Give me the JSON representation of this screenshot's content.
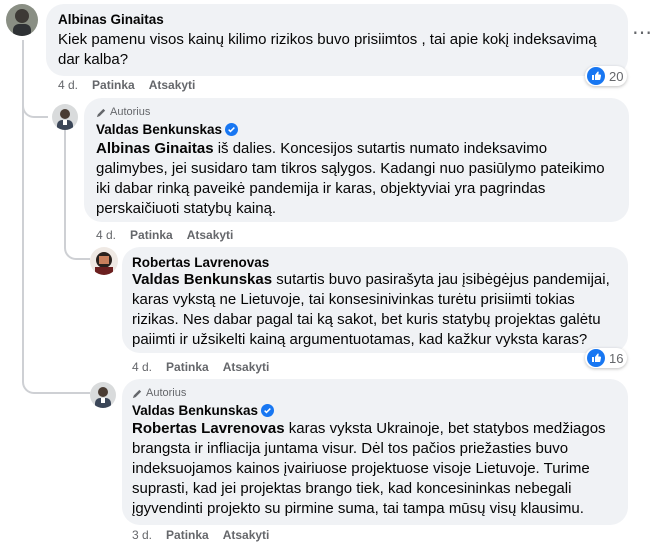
{
  "comments": [
    {
      "author": "Albinas Ginaitas",
      "text": "Kiek pamenu visos kainų kilimo rizikos buvo prisiimtos , tai apie kokį indeksavimą dar kalba?",
      "time": "4 d.",
      "like_label": "Patinka",
      "reply_label": "Atsakyti",
      "reactions": "20"
    },
    {
      "author_badge": "Autorius",
      "author": "Valdas Benkunskas",
      "mention": "Albinas Ginaitas",
      "text": " iš dalies. Koncesijos sutartis numato indeksavimo galimybes, jei susidaro tam tikros sąlygos. Kadangi nuo pasiūlymo pateikimo iki dabar rinką paveikė pandemija ir karas, objektyviai yra pagrindas perskaičiuoti statybų kainą.",
      "time": "4 d.",
      "like_label": "Patinka",
      "reply_label": "Atsakyti"
    },
    {
      "author": "Robertas Lavrenovas",
      "mention": "Valdas Benkunskas",
      "text": " sutartis buvo pasirašyta jau įsibėgėjus pandemijai, karas vykstą ne Lietuvoje, tai konsesinivinkas turėtu prisiimti tokias rizikas. Nes dabar pagal tai ką sakot, bet kuris statybų projektas galėtu paiimti ir užsikelti kainą argumentuotamas, kad kažkur vyksta karas?",
      "time": "4 d.",
      "like_label": "Patinka",
      "reply_label": "Atsakyti",
      "reactions": "16"
    },
    {
      "author_badge": "Autorius",
      "author": "Valdas Benkunskas",
      "mention": "Robertas Lavrenovas",
      "text": " karas vyksta Ukrainoje, bet statybos medžiagos brangsta ir infliacija juntama visur. Dėl tos pačios priežasties buvo indeksuojamos kainos įvairiuose projektuose visoje Lietuvoje. Turime suprasti, kad jei projektas brango tiek, kad koncesininkas nebegali įgyvendinti projekto su pirmine suma, tai tampa mūsų visų klausimu.",
      "time": "3 d.",
      "like_label": "Patinka",
      "reply_label": "Atsakyti"
    }
  ],
  "colors": {
    "bubble": "#f0f2f5",
    "meta": "#65676b",
    "verified": "#1877f2",
    "like": "#1877f2"
  }
}
